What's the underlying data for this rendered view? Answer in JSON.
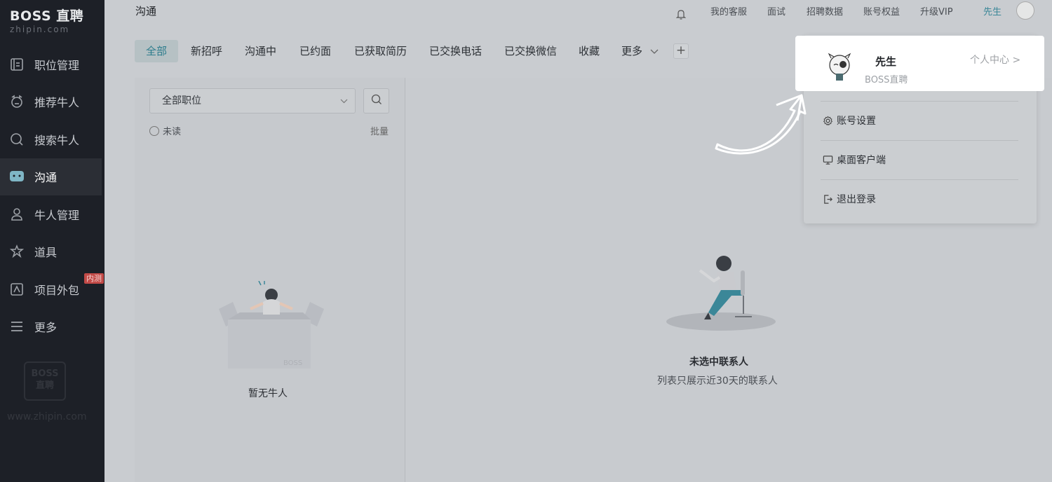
{
  "sidebar": {
    "logo_main": "BOSS 直聘",
    "logo_sub": "zhipin.com",
    "items": [
      {
        "label": "职位管理",
        "icon": "job-management-icon"
      },
      {
        "label": "推荐牛人",
        "icon": "recommend-icon"
      },
      {
        "label": "搜索牛人",
        "icon": "search-icon"
      },
      {
        "label": "沟通",
        "icon": "chat-icon",
        "active": true
      },
      {
        "label": "牛人管理",
        "icon": "talent-management-icon"
      },
      {
        "label": "道具",
        "icon": "tools-icon"
      },
      {
        "label": "项目外包",
        "icon": "outsourcing-icon",
        "badge": "内测"
      },
      {
        "label": "更多",
        "icon": "more-menu-icon"
      }
    ],
    "watermark": "BOSS 直聘",
    "url": "www.zhipin.com"
  },
  "topbar": {
    "title": "沟通",
    "links": [
      "我的客服",
      "面试",
      "招聘数据",
      "账号权益",
      "升级VIP"
    ],
    "user": "先生"
  },
  "tabs": [
    {
      "label": "全部",
      "active": true
    },
    {
      "label": "新招呼"
    },
    {
      "label": "沟通中"
    },
    {
      "label": "已约面"
    },
    {
      "label": "已获取简历"
    },
    {
      "label": "已交换电话"
    },
    {
      "label": "已交换微信"
    },
    {
      "label": "收藏"
    },
    {
      "label": "更多"
    }
  ],
  "left_panel": {
    "select_value": "全部职位",
    "unread_label": "未读",
    "batch_label": "批量",
    "empty_text": "暂无牛人",
    "box_label": "BOSS"
  },
  "right_panel": {
    "empty_title": "未选中联系人",
    "empty_sub": "列表只展示近30天的联系人"
  },
  "profile_menu": {
    "name": "先生",
    "company": "BOSS直聘",
    "link": "个人中心 >",
    "items": [
      {
        "label": "账号设置",
        "icon": "gear-icon"
      },
      {
        "label": "桌面客户端",
        "icon": "desktop-icon"
      },
      {
        "label": "退出登录",
        "icon": "logout-icon"
      }
    ]
  },
  "colors": {
    "sidebar_bg": "#1d2027",
    "accent": "#3b8798",
    "badge": "#c24a47",
    "highlight": "#ffffff"
  }
}
